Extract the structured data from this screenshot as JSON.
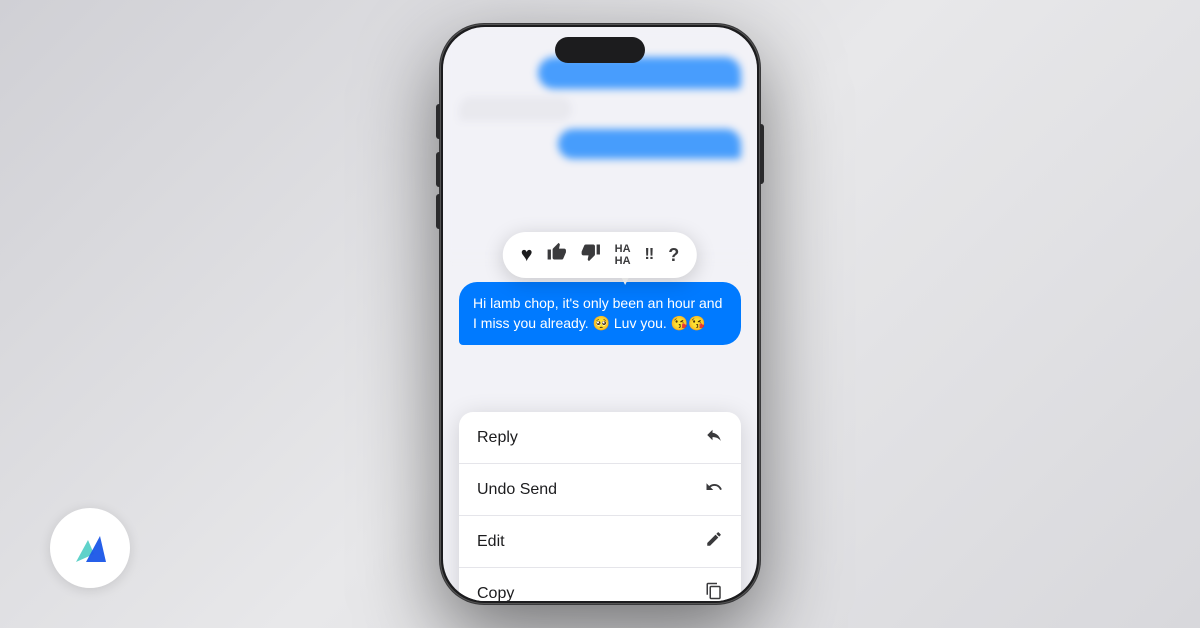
{
  "background": {
    "color": "#e8e8ea"
  },
  "phone": {
    "frameColor": "#1c1c1e",
    "screenColor": "#f2f2f7"
  },
  "reactions": {
    "items": [
      {
        "id": "heart",
        "symbol": "♥",
        "label": "Heart"
      },
      {
        "id": "thumbs-up",
        "symbol": "👍",
        "label": "Like"
      },
      {
        "id": "thumbs-down",
        "symbol": "👎",
        "label": "Dislike"
      },
      {
        "id": "haha",
        "symbol": "HA\nHA",
        "label": "Haha"
      },
      {
        "id": "exclamation",
        "symbol": "‼",
        "label": "Emphasize"
      },
      {
        "id": "question",
        "symbol": "?",
        "label": "Question"
      }
    ]
  },
  "message": {
    "text": "Hi lamb chop, it's only been an hour and I miss you already. 🥺 Luv you. 😘😘"
  },
  "contextMenu": {
    "items": [
      {
        "id": "reply",
        "label": "Reply",
        "icon": "↩"
      },
      {
        "id": "undo-send",
        "label": "Undo Send",
        "icon": "↩"
      },
      {
        "id": "edit",
        "label": "Edit",
        "icon": "✏"
      },
      {
        "id": "copy",
        "label": "Copy",
        "icon": "⧉"
      }
    ]
  },
  "logo": {
    "ariaLabel": "Alchemy logo"
  }
}
